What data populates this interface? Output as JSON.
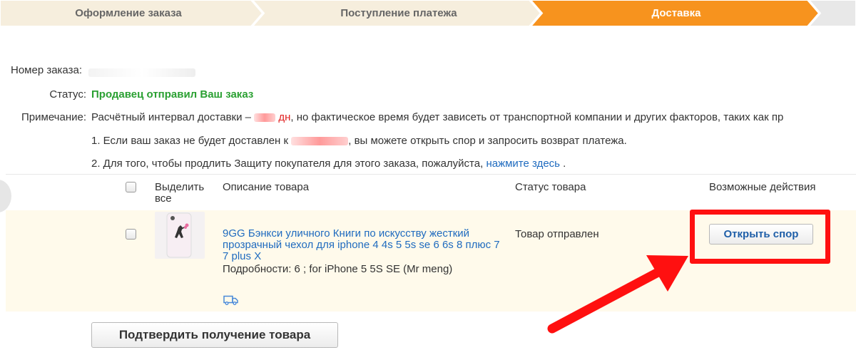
{
  "steps": [
    {
      "label": "Оформление заказа",
      "state": "done"
    },
    {
      "label": "Поступление платежа",
      "state": "done"
    },
    {
      "label": "Доставка",
      "state": "active"
    }
  ],
  "colors": {
    "step_inactive": "#f6eedd",
    "step_active": "#f7931e",
    "status_green": "#2aa032",
    "link_blue": "#1f6bbf",
    "highlight_red": "#ff1010",
    "row_bg": "#fffaeb"
  },
  "order": {
    "number_label": "Номер заказа:",
    "status_label": "Статус:",
    "status_value": "Продавец отправил Ваш заказ",
    "note_label": "Примечание:",
    "note_prefix": "Расчётный интервал доставки –",
    "note_days": "дн",
    "note_suffix": ", но фактическое время будет зависеть от транспортной компании и других факторов, таких как пр",
    "line1_prefix": "1. Если ваш заказ не будет доставлен к",
    "line1_suffix": ", вы можете открыть спор и запросить возврат платежа.",
    "line2_prefix": "2. Для того, чтобы продлить Защиту покупателя для этого заказа, пожалуйста,",
    "line2_link": "нажмите здесь",
    "line2_suffix": "."
  },
  "table": {
    "headers": {
      "select_all": "Выделить все",
      "description": "Описание товара",
      "item_status": "Статус товара",
      "actions": "Возможные действия"
    },
    "rows": [
      {
        "title": "9GG Бэнкси уличного Книги по искусству жесткий прозрачный чехол для iphone 4 4s 5 5s se 6 6s 8 плюс 7 7 plus X",
        "details": "Подробности: 6   ; for iPhone 5 5S SE (Mr meng)",
        "status": "Товар отправлен",
        "action_label": "Открыть спор",
        "icon": "delivery-truck-icon"
      }
    ]
  },
  "confirm_label": "Подтвердить получение товара"
}
